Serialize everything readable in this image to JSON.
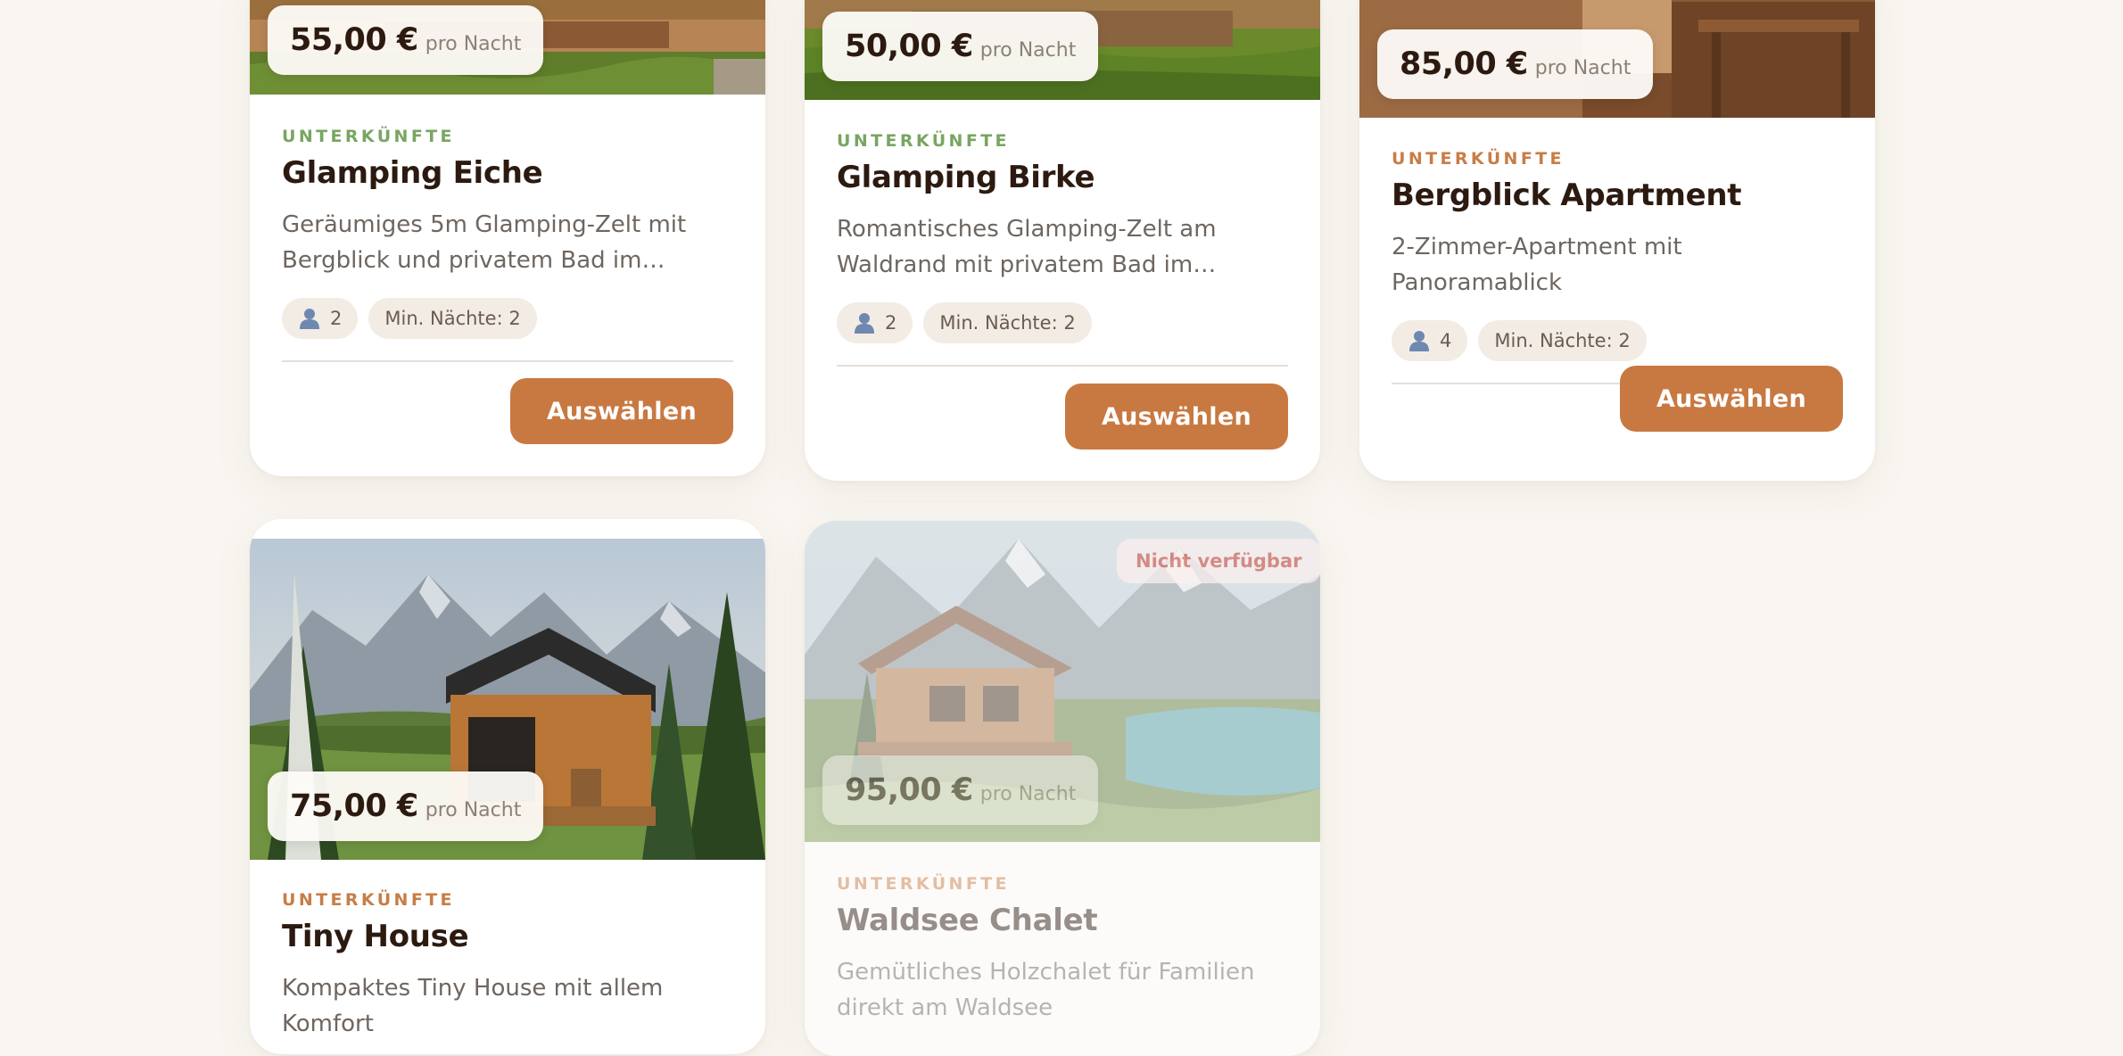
{
  "price_unit": "pro Nacht",
  "colors": {
    "accent": "#c87941",
    "category_green": "#79a562",
    "category_orange": "#c87d47",
    "background": "#f9f6f1",
    "badge_text": "#cf6a62"
  },
  "cards": [
    {
      "price": "55,00 €",
      "category": "UNTERKÜNFTE",
      "title": "Glamping Eiche",
      "description": "Geräumiges 5m Glamping-Zelt mit Bergblick und privatem Bad im separaten…",
      "guests_icon": "person-icon",
      "guests": "2",
      "min_nights": "Min. Nächte: 2",
      "button": "Auswählen"
    },
    {
      "price": "50,00 €",
      "category": "UNTERKÜNFTE",
      "title": "Glamping Birke",
      "description": "Romantisches Glamping-Zelt am Waldrand mit privatem Bad im separaten…",
      "guests_icon": "person-icon",
      "guests": "2",
      "min_nights": "Min. Nächte: 2",
      "button": "Auswählen"
    },
    {
      "price": "85,00 €",
      "category": "UNTERKÜNFTE",
      "title": "Bergblick Apartment",
      "description": "2-Zimmer-Apartment mit Panoramablick",
      "guests_icon": "person-icon",
      "guests": "4",
      "min_nights": "Min. Nächte: 2",
      "button": "Auswählen"
    },
    {
      "price": "75,00 €",
      "category": "UNTERKÜNFTE",
      "title": "Tiny House",
      "description": "Kompaktes Tiny House mit allem Komfort"
    },
    {
      "price": "95,00 €",
      "category": "UNTERKÜNFTE",
      "title": "Waldsee Chalet",
      "description": "Gemütliches Holzchalet für Familien direkt am Waldsee",
      "status_badge": "Nicht verfügbar"
    }
  ]
}
